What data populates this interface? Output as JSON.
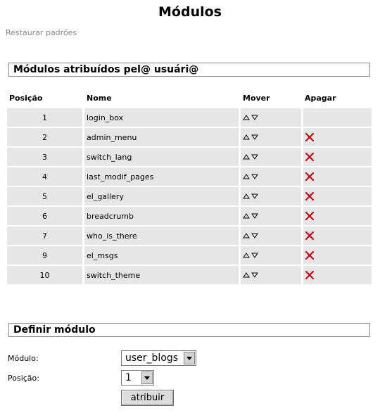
{
  "page": {
    "title": "Módulos",
    "restore_link": "Restaurar padrões"
  },
  "assigned": {
    "heading": "Módulos atribuídos pel@ usuári@",
    "columns": {
      "position": "Posição",
      "name": "Nome",
      "move": "Mover",
      "delete": "Apagar"
    },
    "rows": [
      {
        "position": "1",
        "name": "login_box",
        "deletable": false
      },
      {
        "position": "2",
        "name": "admin_menu",
        "deletable": true
      },
      {
        "position": "3",
        "name": "switch_lang",
        "deletable": true
      },
      {
        "position": "4",
        "name": "last_modif_pages",
        "deletable": true
      },
      {
        "position": "5",
        "name": "el_gallery",
        "deletable": true
      },
      {
        "position": "6",
        "name": "breadcrumb",
        "deletable": true
      },
      {
        "position": "7",
        "name": "who_is_there",
        "deletable": true
      },
      {
        "position": "9",
        "name": "el_msgs",
        "deletable": true
      },
      {
        "position": "10",
        "name": "switch_theme",
        "deletable": true
      }
    ]
  },
  "define": {
    "heading": "Definir módulo",
    "module_label": "Módulo:",
    "module_value": "user_blogs",
    "position_label": "Posição:",
    "position_value": "1",
    "submit_label": "atribuir"
  },
  "colors": {
    "row_shade": "#e6e6e6",
    "delete_icon": "#cc0000",
    "muted_link": "#888888"
  },
  "icons": {
    "move_up": "triangle-up-outline-icon",
    "move_down": "triangle-down-outline-icon",
    "delete": "red-x-icon",
    "dropdown": "chevron-down-icon"
  }
}
